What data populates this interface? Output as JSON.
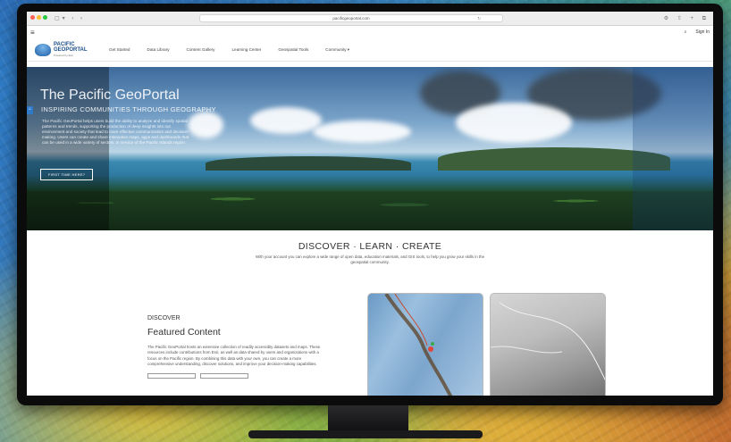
{
  "browser": {
    "url": "pacificgeoportal.com"
  },
  "util": {
    "signin": "Sign In"
  },
  "brand": {
    "line1": "PACIFIC",
    "line2": "GEOPORTAL",
    "tag": "Powered by Esri"
  },
  "nav": [
    "Get Started",
    "Data Library",
    "Content Gallery",
    "Learning Center",
    "Geospatial Tools",
    "Community ▾"
  ],
  "hero": {
    "title": "The Pacific GeoPortal",
    "subtitle": "INSPIRING COMMUNITIES THROUGH GEOGRAPHY",
    "body": "The Pacific GeoPortal helps users build the ability to analyze and identify spatial patterns and trends, supporting the production of deep insights into our environment and society that lead to more effective communication and decision-making. Users can create and share interactive maps, apps and dashboards that can be used in a wide variety of sectors, in service of the Pacific Islands region.",
    "button": "FIRST TIME HERE?"
  },
  "discover": {
    "title": "DISCOVER · LEARN · CREATE",
    "subtitle": "With your account you can explore a wide range of open data, education materials, and GIS tools, to help you grow your skills in the geospatial community."
  },
  "featured": {
    "kicker": "DISCOVER",
    "heading": "Featured Content",
    "body": "The Pacific GeoPortal hosts an extensive collection of readily accessibly datasets and maps. These resources include contributions from Esri, as well as data shared by users and organizations with a focus on the Pacific region. By combining this data with your own, you can create a more comprehensive understanding, discover solutions, and improve your decision-making capabilities."
  }
}
